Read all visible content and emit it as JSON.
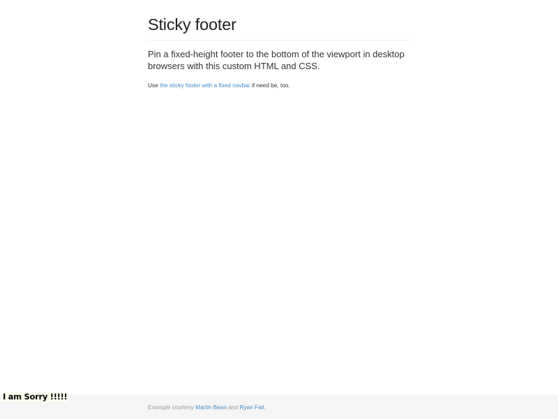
{
  "header": {
    "title": "Sticky footer"
  },
  "main": {
    "lead": "Pin a fixed-height footer to the bottom of the viewport in desktop browsers with this custom HTML and CSS.",
    "note": {
      "prefix": "Use ",
      "link": "the sticky footer with a fixed navbar",
      "suffix": " if need be, too."
    }
  },
  "footer": {
    "prefix": "Example courtesy ",
    "link1": "Martin Bean",
    "middle": " and ",
    "link2": "Ryan Fait",
    "suffix": "."
  },
  "overlay": {
    "text": "I am Sorry !!!!!"
  },
  "colors": {
    "link": "#428bca",
    "footer_bg": "#f5f5f5",
    "footer_text": "#999999"
  }
}
